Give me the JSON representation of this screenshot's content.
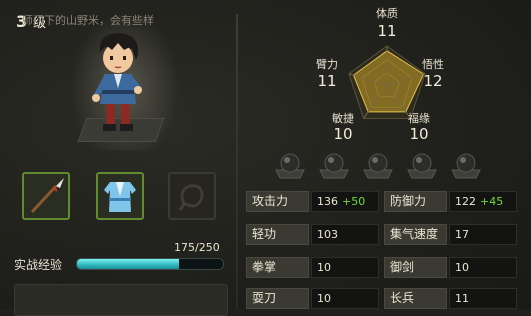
{
  "level": {
    "value": "3",
    "unit": "级"
  },
  "equipment": [
    {
      "name": "spear",
      "empty": false
    },
    {
      "name": "robe",
      "empty": false
    },
    {
      "name": "accessory",
      "empty": true
    }
  ],
  "exp": {
    "label": "实战经验",
    "current": 175,
    "max": 250,
    "text": "175/250"
  },
  "description": {
    "text": "师门下的山野米，会有些样"
  },
  "radar": {
    "stats": [
      {
        "label": "体质",
        "value": "11"
      },
      {
        "label": "悟性",
        "value": "12"
      },
      {
        "label": "福缘",
        "value": "10"
      },
      {
        "label": "敏捷",
        "value": "10"
      },
      {
        "label": "臂力",
        "value": "11"
      }
    ],
    "max": 20
  },
  "gems": {
    "count": 5
  },
  "stats_table": [
    [
      {
        "key": "攻击力",
        "value": "136",
        "bonus": "+50"
      },
      {
        "key": "防御力",
        "value": "122",
        "bonus": "+45"
      }
    ],
    [
      {
        "key": "轻功",
        "value": "103",
        "bonus": ""
      },
      {
        "key": "集气速度",
        "value": "17",
        "bonus": ""
      }
    ],
    [
      {
        "key": "拳掌",
        "value": "10",
        "bonus": ""
      },
      {
        "key": "御剑",
        "value": "10",
        "bonus": ""
      }
    ],
    [
      {
        "key": "耍刀",
        "value": "10",
        "bonus": ""
      },
      {
        "key": "长兵",
        "value": "11",
        "bonus": ""
      }
    ]
  ],
  "colors": {
    "accent": "#5f8d2e",
    "exp_bar": "#2fb7bd",
    "bonus": "#6fdc3c",
    "radar_fill": "#c9a126"
  }
}
